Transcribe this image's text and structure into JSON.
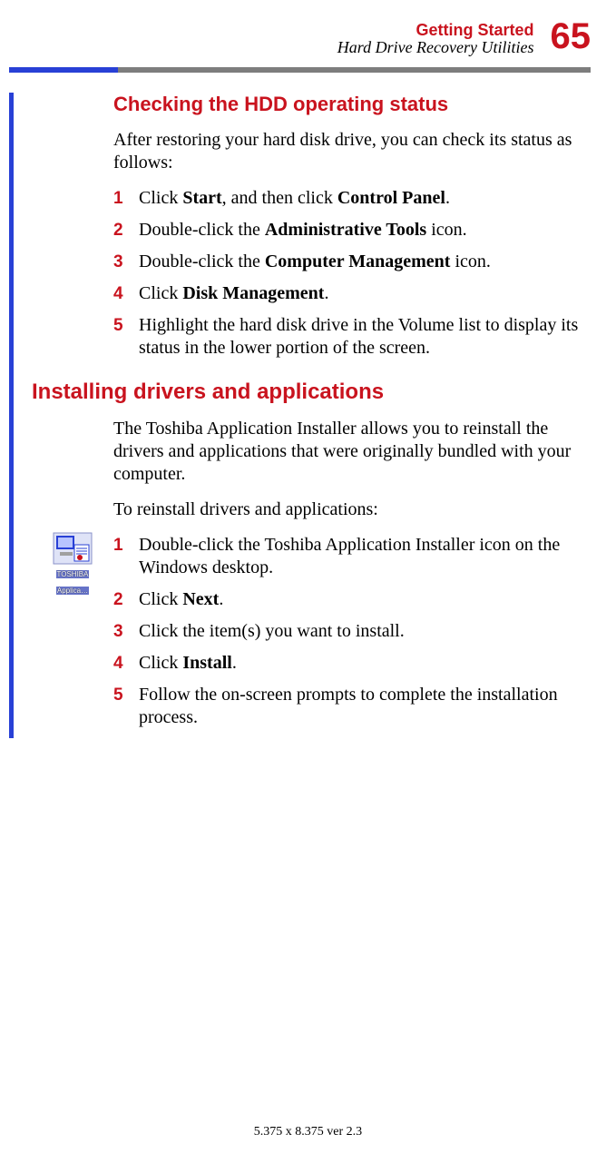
{
  "header": {
    "chapter": "Getting Started",
    "section": "Hard Drive Recovery Utilities",
    "page_number": "65"
  },
  "h3": "Checking the HDD operating status",
  "intro1": "After restoring your hard disk drive, you can check its status as follows:",
  "steps1": {
    "n1": "1",
    "t1a": "Click ",
    "t1b": "Start",
    "t1c": ", and then click ",
    "t1d": "Control Panel",
    "t1e": ".",
    "n2": "2",
    "t2a": "Double-click the ",
    "t2b": "Administrative Tools",
    "t2c": " icon.",
    "n3": "3",
    "t3a": "Double-click the ",
    "t3b": "Computer Management",
    "t3c": " icon.",
    "n4": "4",
    "t4a": "Click ",
    "t4b": "Disk Management",
    "t4c": ".",
    "n5": "5",
    "t5": "Highlight the hard disk drive in the Volume list to display its status in the lower portion of the screen."
  },
  "h2": "Installing drivers and applications",
  "intro2": "The Toshiba Application Installer allows you to reinstall the drivers and applications that were originally bundled with your computer.",
  "intro3": "To reinstall drivers and applications:",
  "icon": {
    "caption1": "TOSHIBA",
    "caption2": "Applica…"
  },
  "steps2": {
    "n1": "1",
    "t1": "Double-click the Toshiba Application Installer icon on the Windows desktop.",
    "n2": "2",
    "t2a": "Click ",
    "t2b": "Next",
    "t2c": ".",
    "n3": "3",
    "t3": "Click the item(s) you want to install.",
    "n4": "4",
    "t4a": "Click ",
    "t4b": "Install",
    "t4c": ".",
    "n5": "5",
    "t5": "Follow the on-screen prompts to complete the installation process."
  },
  "footer": "5.375 x 8.375 ver 2.3"
}
